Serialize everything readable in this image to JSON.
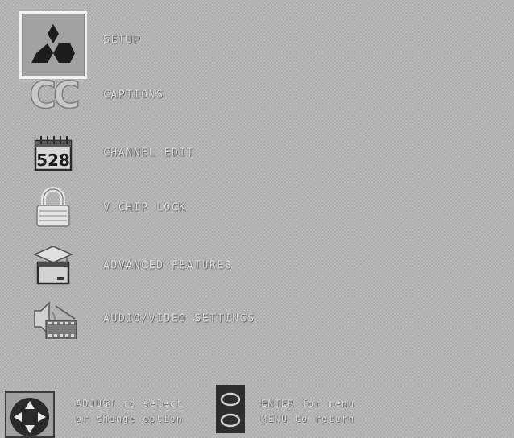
{
  "menu": {
    "items": [
      {
        "id": "setup",
        "label": "SETUP",
        "icon": "mitsubishi-logo-icon",
        "selected": true
      },
      {
        "id": "captions",
        "label": "CAPTIONS",
        "icon": "cc-icon",
        "icon_text": "CC",
        "selected": false
      },
      {
        "id": "channel_edit",
        "label": "CHANNEL EDIT",
        "icon": "channel-calendar-icon",
        "icon_text": "528",
        "selected": false
      },
      {
        "id": "v_chip_lock",
        "label": "V-CHIP LOCK",
        "icon": "padlock-icon",
        "selected": false
      },
      {
        "id": "advanced_features",
        "label": "ADVANCED FEATURES",
        "icon": "graduation-cap-box-icon",
        "selected": false
      },
      {
        "id": "audio_video_settings",
        "label": "AUDIO/VIDEO SETTINGS",
        "icon": "speaker-film-icon",
        "selected": false
      }
    ]
  },
  "help": {
    "adjust_line1": "ADJUST to select",
    "adjust_line2": "or change option",
    "enter_line1": "ENTER for menu",
    "enter_line2": "MENU to return"
  },
  "colors": {
    "background": "#b4b4b4",
    "text": "#dcdcdc",
    "highlight_border": "#f2f2f2"
  }
}
